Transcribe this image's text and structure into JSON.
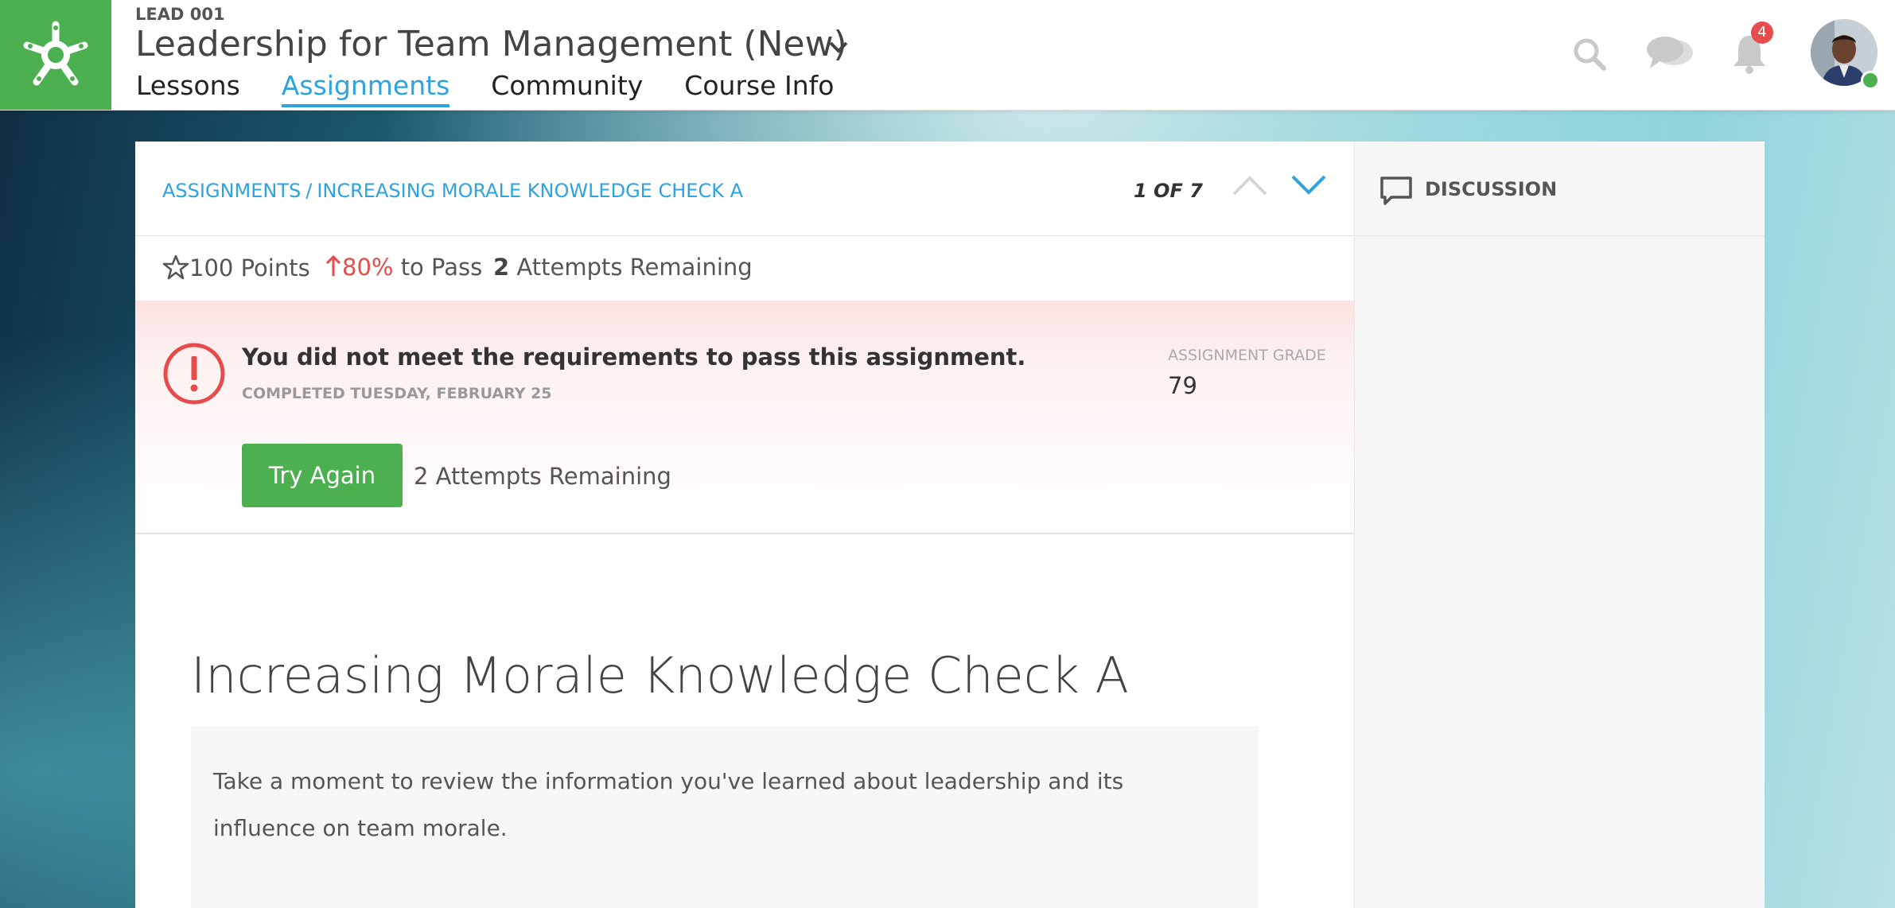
{
  "header": {
    "course_code": "LEAD 001",
    "course_title": "Leadership for Team Management (New)",
    "tabs": [
      {
        "label": "Lessons",
        "active": false
      },
      {
        "label": "Assignments",
        "active": true
      },
      {
        "label": "Community",
        "active": false
      },
      {
        "label": "Course Info",
        "active": false
      }
    ],
    "icons": [
      "search-icon",
      "chat-icon",
      "bell-icon"
    ],
    "notification_count": "4",
    "accent_color": "#2ea3df",
    "brand_color": "#4cb050"
  },
  "assignment": {
    "breadcrumb": {
      "root": "ASSIGNMENTS",
      "separator": "/",
      "current": "INCREASING MORALE KNOWLEDGE CHECK A"
    },
    "pager": "1 OF 7",
    "points": "100 Points",
    "pass_pct": "80%",
    "pass_suffix": "to Pass",
    "attempts_count": "2",
    "attempts_label": "Attempts Remaining",
    "title": "Increasing Morale Knowledge Check A",
    "instructions": "Take a moment to review the information you've learned about leadership and its influence on team morale."
  },
  "alert": {
    "message": "You did not meet the requirements to pass this assignment.",
    "completed": "COMPLETED TUESDAY, FEBRUARY 25",
    "grade_label": "ASSIGNMENT GRADE",
    "grade_value": "79",
    "try_again_label": "Try Again",
    "attempts_text": "2 Attempts Remaining",
    "error_color": "#e84b4b"
  },
  "sidebar": {
    "discussion_label": "DISCUSSION"
  }
}
